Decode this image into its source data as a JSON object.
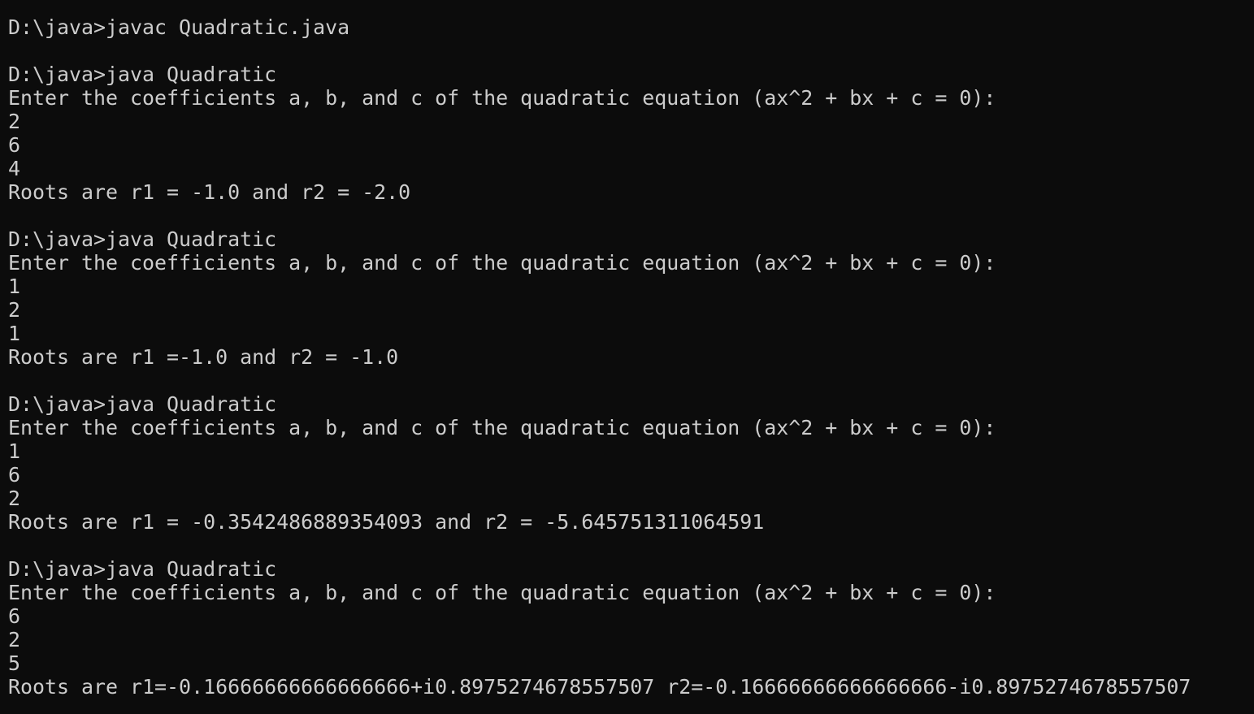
{
  "terminal": {
    "lines": [
      "D:\\java>javac Quadratic.java",
      "",
      "D:\\java>java Quadratic",
      "Enter the coefficients a, b, and c of the quadratic equation (ax^2 + bx + c = 0):",
      "2",
      "6",
      "4",
      "Roots are r1 = -1.0 and r2 = -2.0",
      "",
      "D:\\java>java Quadratic",
      "Enter the coefficients a, b, and c of the quadratic equation (ax^2 + bx + c = 0):",
      "1",
      "2",
      "1",
      "Roots are r1 =-1.0 and r2 = -1.0",
      "",
      "D:\\java>java Quadratic",
      "Enter the coefficients a, b, and c of the quadratic equation (ax^2 + bx + c = 0):",
      "1",
      "6",
      "2",
      "Roots are r1 = -0.3542486889354093 and r2 = -5.645751311064591",
      "",
      "D:\\java>java Quadratic",
      "Enter the coefficients a, b, and c of the quadratic equation (ax^2 + bx + c = 0):",
      "6",
      "2",
      "5",
      "Roots are r1=-0.16666666666666666+i0.8975274678557507 r2=-0.16666666666666666-i0.8975274678557507"
    ],
    "colors": {
      "background": "#0c0c0c",
      "text": "#cccccc"
    }
  }
}
